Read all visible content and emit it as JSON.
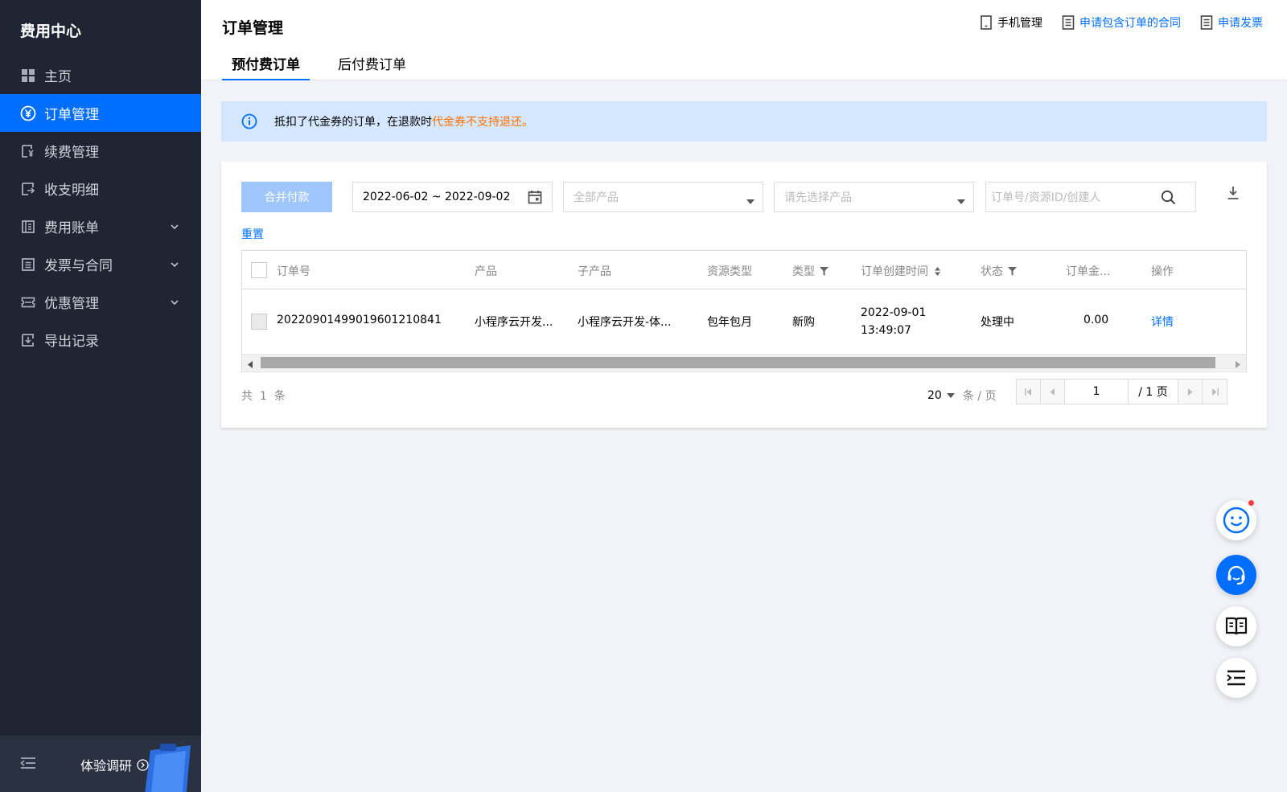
{
  "sidebar": {
    "title": "费用中心",
    "items": [
      {
        "label": "主页",
        "icon": "grid-icon"
      },
      {
        "label": "订单管理",
        "icon": "yuan-circle-icon"
      },
      {
        "label": "续费管理",
        "icon": "renew-icon"
      },
      {
        "label": "收支明细",
        "icon": "ledger-icon"
      },
      {
        "label": "费用账单",
        "icon": "bill-icon"
      },
      {
        "label": "发票与合同",
        "icon": "invoice-icon"
      },
      {
        "label": "优惠管理",
        "icon": "coupon-icon"
      },
      {
        "label": "导出记录",
        "icon": "export-icon"
      }
    ],
    "survey_label": "体验调研"
  },
  "header": {
    "title": "订单管理",
    "links": {
      "phone": "手机管理",
      "contract": "申请包含订单的合同",
      "invoice": "申请发票"
    },
    "tabs": [
      "预付费订单",
      "后付费订单"
    ]
  },
  "notice": {
    "text_prefix": "抵扣了代金券的订单，在退款时",
    "text_warn": "代金券不支持退还。"
  },
  "toolbar": {
    "merge_label": "合并付款",
    "date_range": "2022-06-02 ~ 2022-09-02",
    "product_placeholder": "全部产品",
    "subproduct_placeholder": "请先选择产品",
    "search_placeholder": "订单号/资源ID/创建人",
    "reset_label": "重置"
  },
  "table": {
    "columns": [
      "订单号",
      "产品",
      "子产品",
      "资源类型",
      "类型",
      "订单创建时间",
      "状态",
      "订单金...",
      "操作"
    ],
    "rows": [
      {
        "order_id": "20220901499019601210841",
        "product": "小程序云开发...",
        "subproduct": "小程序云开发-体...",
        "resource_type": "包年包月",
        "type": "新购",
        "created_date": "2022-09-01",
        "created_time": "13:49:07",
        "status": "处理中",
        "amount": "0.00",
        "action": "详情"
      }
    ]
  },
  "pagination": {
    "total_prefix": "共",
    "total": "1",
    "total_suffix": "条",
    "page_size": "20",
    "page_size_unit": "条 / 页",
    "current_page": "1",
    "total_pages": "/ 1 页"
  },
  "colors": {
    "sidebar_bg": "#1f2532",
    "accent": "#006eff",
    "warning": "#ff7200",
    "notice_bg": "#d5e7ff"
  }
}
